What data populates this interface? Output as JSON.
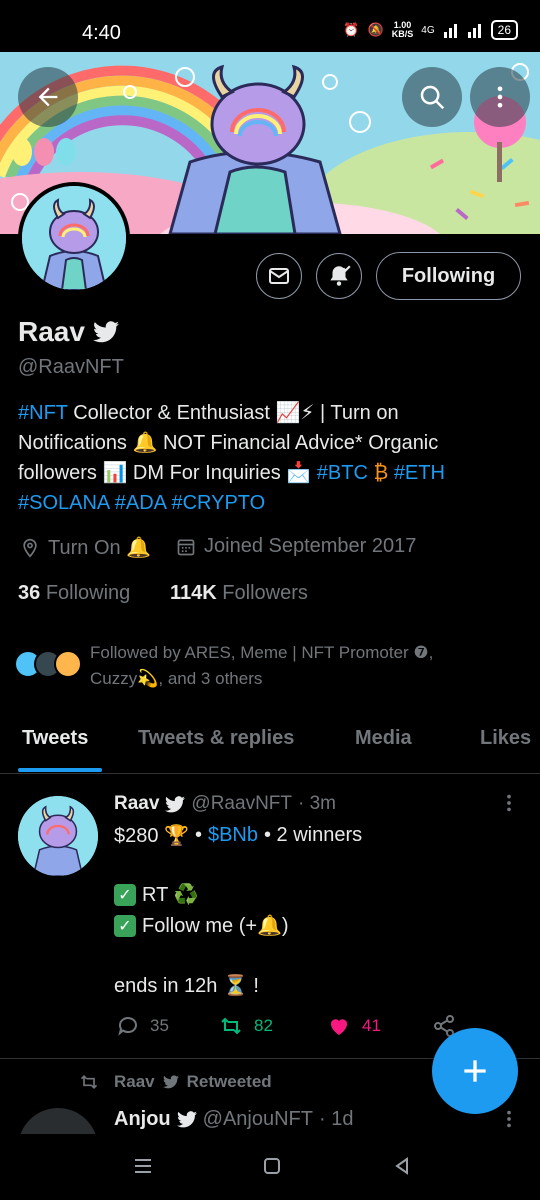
{
  "status_bar": {
    "time": "4:40",
    "net_speed_value": "1.00",
    "net_speed_unit": "KB/S",
    "network": "4G",
    "battery": "26"
  },
  "profile": {
    "name": "Raav",
    "handle": "@RaavNFT",
    "following_button": "Following",
    "bio": {
      "l1_tag": "#NFT",
      "l1_text": " Collector & Enthusiast 📈⚡ | Turn on",
      "l2_text": "Notifications 🔔 NOT Financial Advice* Organic",
      "l3_text": "followers 📊 DM For Inquiries 📩 ",
      "l3_tag1": "#BTC",
      "l3_btc": " ₿ ",
      "l3_tag2": " #ETH",
      "l4_tag1": "#SOLANA",
      "l4_tag2": "#ADA",
      "l4_tag3": "#CRYPTO"
    },
    "location": "Turn On 🔔",
    "joined": "Joined September 2017",
    "following_count": "36",
    "following_label": "Following",
    "followers_count": "114K",
    "followers_label": "Followers",
    "followed_by_line1": "Followed by ARES, Meme | NFT Promoter ❼,",
    "followed_by_line2": "Cuzzy💫, and 3 others"
  },
  "tabs": [
    "Tweets",
    "Tweets & replies",
    "Media",
    "Likes"
  ],
  "tweet": {
    "name": "Raav",
    "handle": "@RaavNFT",
    "time": "· 3m",
    "line1_amount": "$280 🏆",
    "line1_dot": "•",
    "line1_tag": "$BNb",
    "line1_rest": "• 2 winners",
    "line2": "RT ♻️",
    "line3": "Follow me (+🔔)",
    "line4": "ends in 12h ⏳ !",
    "replies": "35",
    "retweets": "82",
    "likes": "41"
  },
  "retweet_row": {
    "name": "Raav",
    "label": "Retweeted"
  },
  "tweet2": {
    "name": "Anjou",
    "handle": "@AnjouNFT",
    "time": "· 1d"
  },
  "colors": {
    "accent": "#1d9bf0",
    "retweet_green": "#00ba7c",
    "like_pink": "#f91880"
  }
}
